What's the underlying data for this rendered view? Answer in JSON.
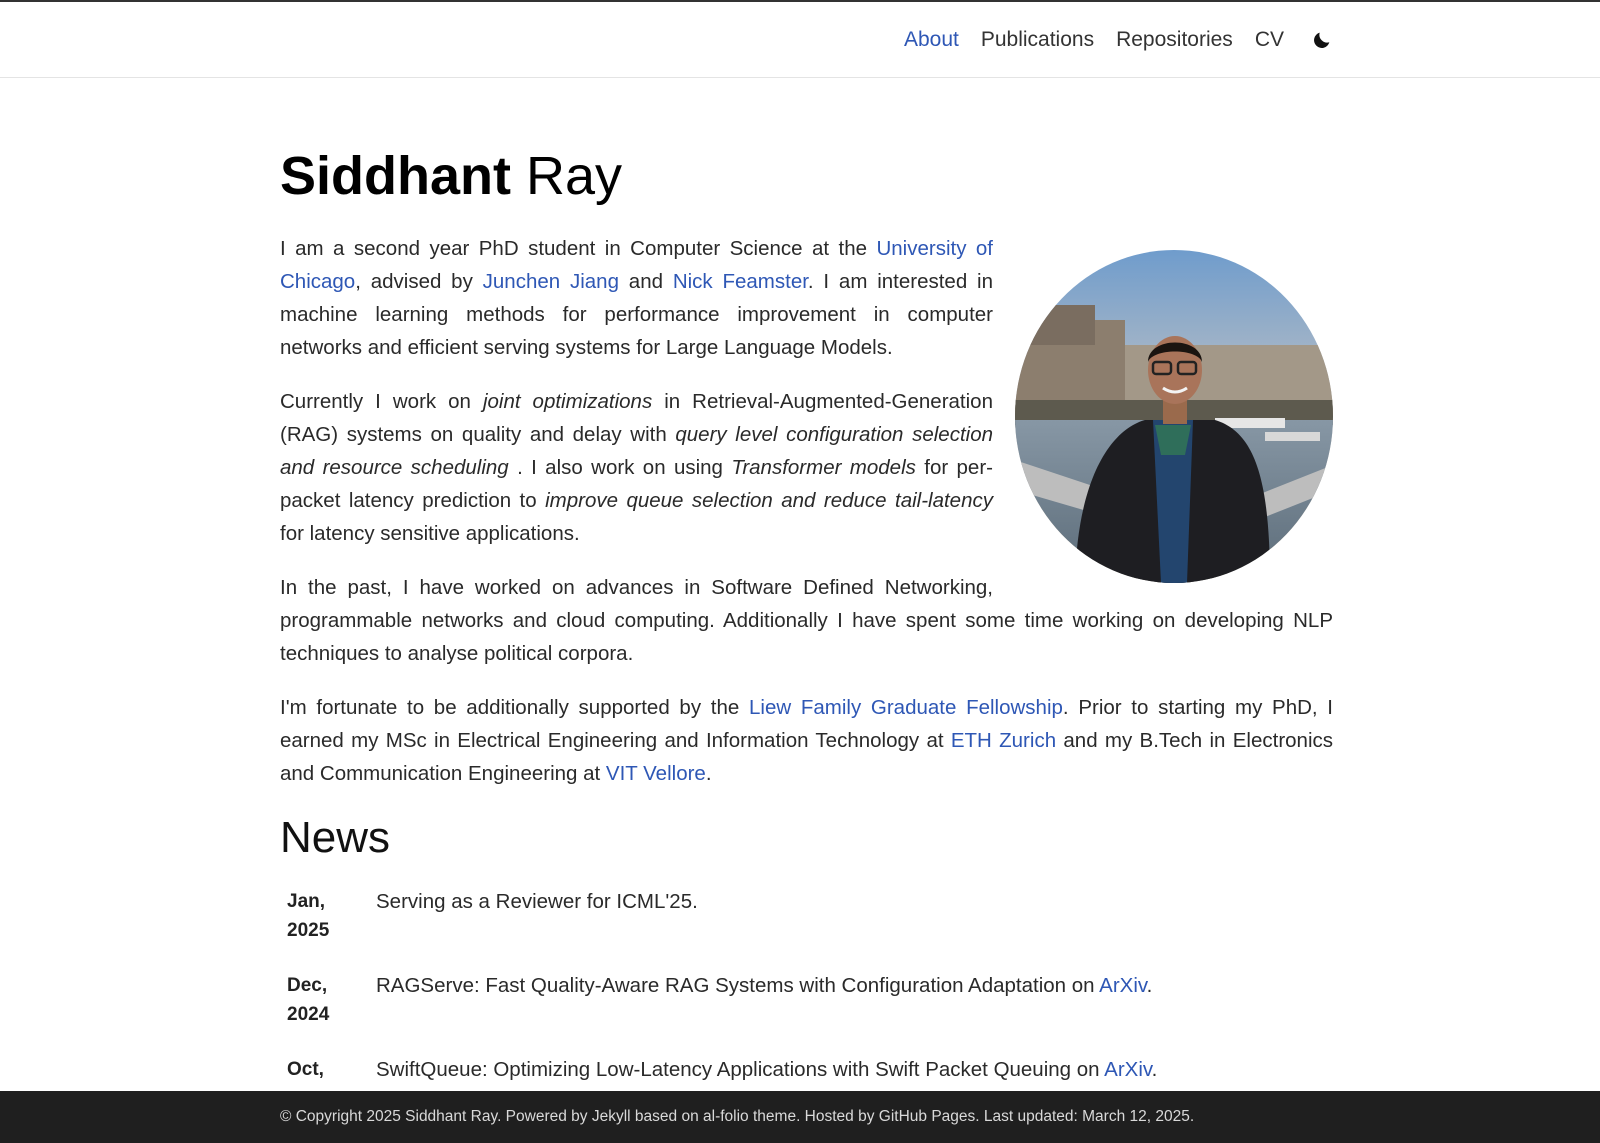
{
  "nav": {
    "items": [
      {
        "label": "About",
        "active": true
      },
      {
        "label": "Publications",
        "active": false
      },
      {
        "label": "Repositories",
        "active": false
      },
      {
        "label": "CV",
        "active": false
      }
    ],
    "theme_icon": "moon-icon",
    "accent_color": "#2e57b5"
  },
  "profile": {
    "first_name": "Siddhant",
    "last_name": "Ray"
  },
  "bio": {
    "p1": {
      "t1": "I am a second year PhD student in Computer Science at the ",
      "link1": "University of Chicago",
      "t2": ", advised by ",
      "link2": "Junchen Jiang",
      "t3": " and ",
      "link3": "Nick Feamster",
      "t4": ". I am interested in machine learning methods for performance improvement in computer networks and efficient serving systems for Large Language Models."
    },
    "p2": {
      "t1": "Currently I work on ",
      "em1": "joint optimizations",
      "t2": " in Retrieval-Augmented-Generation (RAG) systems on quality and delay with ",
      "em2": "query level configuration selection and resource scheduling",
      "t3": " . I also work on using ",
      "em3": "Transformer models",
      "t4": " for per-packet latency prediction to ",
      "em4": "improve queue selection and reduce tail-latency",
      "t5": " for latency sensitive applications."
    },
    "p3": "In the past, I have worked on advances in Software Defined Networking, programmable networks and cloud computing. Additionally I have spent some time working on developing NLP techniques to analyse political corpora.",
    "p4": {
      "t1": "I'm fortunate to be additionally supported by the ",
      "link1": "Liew Family Graduate Fellowship",
      "t2": ". Prior to starting my PhD, I earned my MSc in Electrical Engineering and Information Technology at ",
      "link2": "ETH Zurich",
      "t3": " and my B.Tech in Electronics and Communication Engineering at ",
      "link3": "VIT Vellore",
      "t4": "."
    }
  },
  "news": {
    "heading": "News",
    "items": [
      {
        "date_month": "Jan,",
        "date_year": "2025",
        "text": "Serving as a Reviewer for ICML'25.",
        "link": ""
      },
      {
        "date_month": "Dec,",
        "date_year": "2024",
        "text": "RAGServe: Fast Quality-Aware RAG Systems with Configuration Adaptation on ",
        "link": "ArXiv",
        "after": "."
      },
      {
        "date_month": "Oct,",
        "date_year": "",
        "text": "SwiftQueue: Optimizing Low-Latency Applications with Swift Packet Queuing on ",
        "link": "ArXiv",
        "after": "."
      }
    ]
  },
  "footer": {
    "t1": "© Copyright 2025 Siddhant Ray. Powered by ",
    "link1": "Jekyll",
    "t2": " based on ",
    "link2": "al-folio",
    "t3": " theme. Hosted by ",
    "link3": "GitHub Pages",
    "t4": ". Last updated: March 12, 2025."
  }
}
